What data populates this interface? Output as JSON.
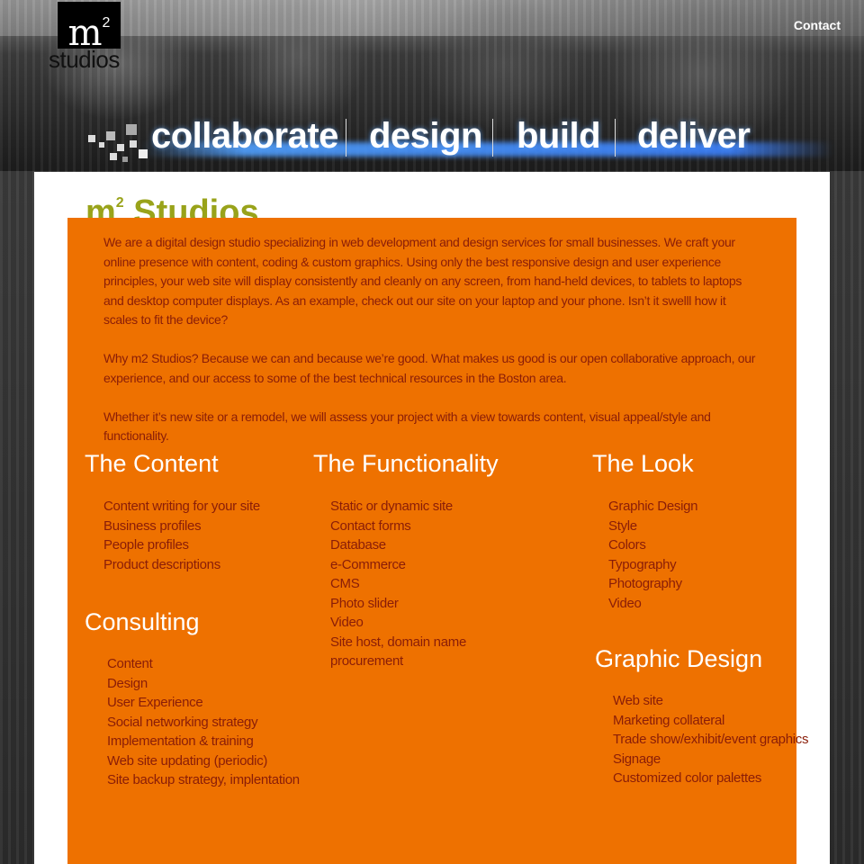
{
  "header": {
    "logo": {
      "mark": "m",
      "superscript": "2",
      "word": "studios"
    },
    "contact_link": "Contact",
    "tagline": [
      "collaborate",
      "design",
      "build",
      "deliver"
    ]
  },
  "main": {
    "headline": {
      "prefix": "m",
      "superscript": "2",
      "suffix": " Studios..."
    },
    "intro": [
      "We are a digital design studio specializing in web development and design services for small businesses. We craft your online presence with content, coding & custom graphics. Using only the best responsive design and user experience principles, your web site will display consistently and cleanly on any screen, from hand-held devices, to tablets to laptops and desktop computer displays. As an example, check out our site on your laptop and your phone.  Isn’t it swelll how it scales to fit the device?",
      "Why m2 Studios? Because we can and because we’re good. What makes us good is our open collaborative approach, our experience, and our access to some of the best technical resources in the Boston area.",
      "Whether it’s new site or a remodel, we will assess your project with a view towards content, visual appeal/style and functionality."
    ],
    "sections": {
      "content": {
        "title": "The Content",
        "items": [
          "Content writing for your site",
          "Business profiles",
          "People profiles",
          "Product descriptions"
        ]
      },
      "functionality": {
        "title": "The Functionality",
        "items": [
          "Static or dynamic site",
          "Contact forms",
          "Database",
          "e-Commerce",
          "CMS",
          "Photo slider",
          "Video",
          "Site host, domain name",
          "procurement"
        ]
      },
      "look": {
        "title": "The Look",
        "items": [
          "Graphic Design",
          "Style",
          "Colors",
          "Typography",
          "Photography",
          "Video"
        ]
      },
      "consulting": {
        "title": "Consulting",
        "items": [
          "Content",
          "Design",
          "User Experience",
          "Social networking strategy",
          "Implementation & training",
          "Web site updating (periodic)",
          "Site backup strategy, implentation"
        ]
      },
      "graphic_design": {
        "title": "Graphic Design",
        "items": [
          "Web site",
          "Marketing collateral",
          "Trade show/exhibit/event graphics",
          "Signage",
          "Customized color palettes"
        ]
      }
    }
  },
  "colors": {
    "orange_panel": "#ee7100",
    "body_text": "#8a1d08",
    "headline_green": "#99a31a",
    "section_title": "#ffffff"
  }
}
